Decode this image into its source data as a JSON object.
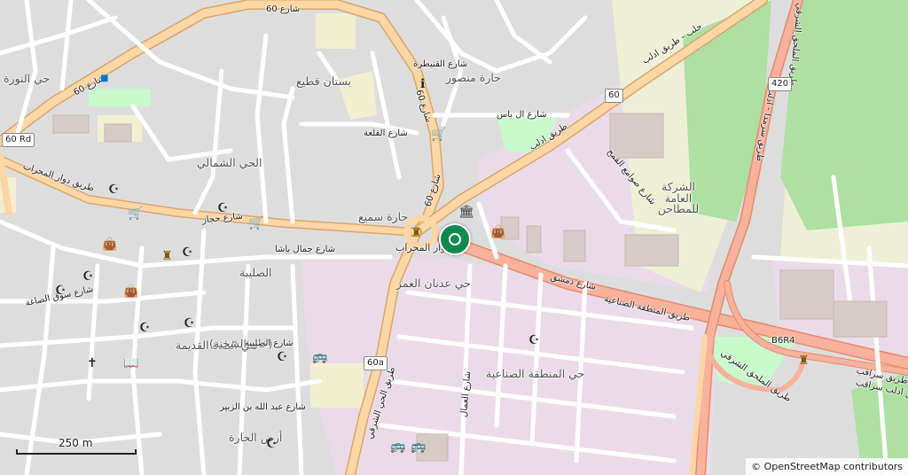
{
  "colors": {
    "background": "#dddddd",
    "residential": "#e0dfdf",
    "industrial": "#ebdbe8",
    "farmland": "#eef0d5",
    "orchard": "#aedfa3",
    "park": "#c8facc",
    "major_road": "#fcd6a4",
    "trunk_road": "#f9b29c",
    "trunk_casing": "#e98a6e",
    "minor_road": "#ffffff",
    "pin": "#0f8a4f"
  },
  "labels": [
    {
      "id": "street-60-top",
      "text": "شارع 60"
    },
    {
      "id": "street-60-left",
      "text": "شارع 60"
    },
    {
      "id": "street-60-mid",
      "text": "شارع 60"
    },
    {
      "id": "street-60-low",
      "text": "شارع 60"
    },
    {
      "id": "aleppo-idlib-rd",
      "text": "حلب - طريق ادلب"
    },
    {
      "id": "idlib-rd",
      "text": "طريق ادلب"
    },
    {
      "id": "haret-mansour",
      "text": "حارة منصور"
    },
    {
      "id": "bustan-qatea",
      "text": "بستان قطيع"
    },
    {
      "id": "hay-shamali",
      "text": "الحي الشمالي"
    },
    {
      "id": "haret-samie",
      "text": "حارة سميع"
    },
    {
      "id": "dawar-mihrab",
      "text": "دوار المحراب"
    },
    {
      "id": "shar-hijaz",
      "text": "شارع حجاز"
    },
    {
      "id": "tariq-dawar-mihrab",
      "text": "طريق دوار المحراب"
    },
    {
      "id": "hay-nawra",
      "text": "حي النورة"
    },
    {
      "id": "hay-adnan-amr",
      "text": "حي عدنان العمر"
    },
    {
      "id": "shar-dimashq",
      "text": "شارع دمشق"
    },
    {
      "id": "tariq-mintaqa",
      "text": "طريق المنطقة الصناعية"
    },
    {
      "id": "hay-mintaqa",
      "text": "حي المنطقة الصناعية"
    },
    {
      "id": "sharika",
      "text": "الشركة العامة للمطاحن"
    },
    {
      "id": "sawami",
      "text": "شارع صوامع القمح"
    },
    {
      "id": "saliba",
      "text": "الصليبة"
    },
    {
      "id": "hay-balda-qadima",
      "text": "حي البلدة القديمة"
    },
    {
      "id": "khan-shahna",
      "text": "(خان الشحنة)"
    },
    {
      "id": "ard-hara",
      "text": "أرض الحارة"
    },
    {
      "id": "tariq-mulhaq",
      "text": "طريق الملحق الشرقي"
    },
    {
      "id": "tariq-saraqib",
      "text": "طريق سراقب"
    },
    {
      "id": "tariq-hay-sharqi",
      "text": "طريق الحي الشرقي"
    },
    {
      "id": "shar-iqbal",
      "text": "شارع العمال"
    },
    {
      "id": "shar-al-bas",
      "text": "شارع ال باس"
    },
    {
      "id": "shar-qalaa",
      "text": "شارع القلعة"
    },
    {
      "id": "shar-qunaytira",
      "text": "شارع القنيطرة"
    },
    {
      "id": "shar-saliba",
      "text": "شارع الصليبة"
    },
    {
      "id": "shar-abdullah",
      "text": "شارع عبد الله بن الزبير"
    },
    {
      "id": "shar-jamal",
      "text": "شارع جمال باشا"
    },
    {
      "id": "shar-suq-saaa",
      "text": "شارع سوق الصاغة"
    },
    {
      "id": "tariq-mulhaq-right",
      "text": "طريق الملحق الشرقي"
    },
    {
      "id": "tariq-serumla-idlib",
      "text": "طريق سرمدا - ادلب"
    },
    {
      "id": "tariq-idlib-saraqib",
      "text": "طريق ادلب سراقب"
    },
    {
      "id": "b6r4",
      "text": "B6R4"
    }
  ],
  "shields": [
    {
      "id": "shield-60",
      "text": "60"
    },
    {
      "id": "shield-60a",
      "text": "60a"
    },
    {
      "id": "shield-420",
      "text": "420"
    },
    {
      "id": "shield-60rd",
      "text": "60 Rd"
    }
  ],
  "scale": {
    "label": "250 m"
  },
  "attribution": "© OpenStreetMap contributors"
}
